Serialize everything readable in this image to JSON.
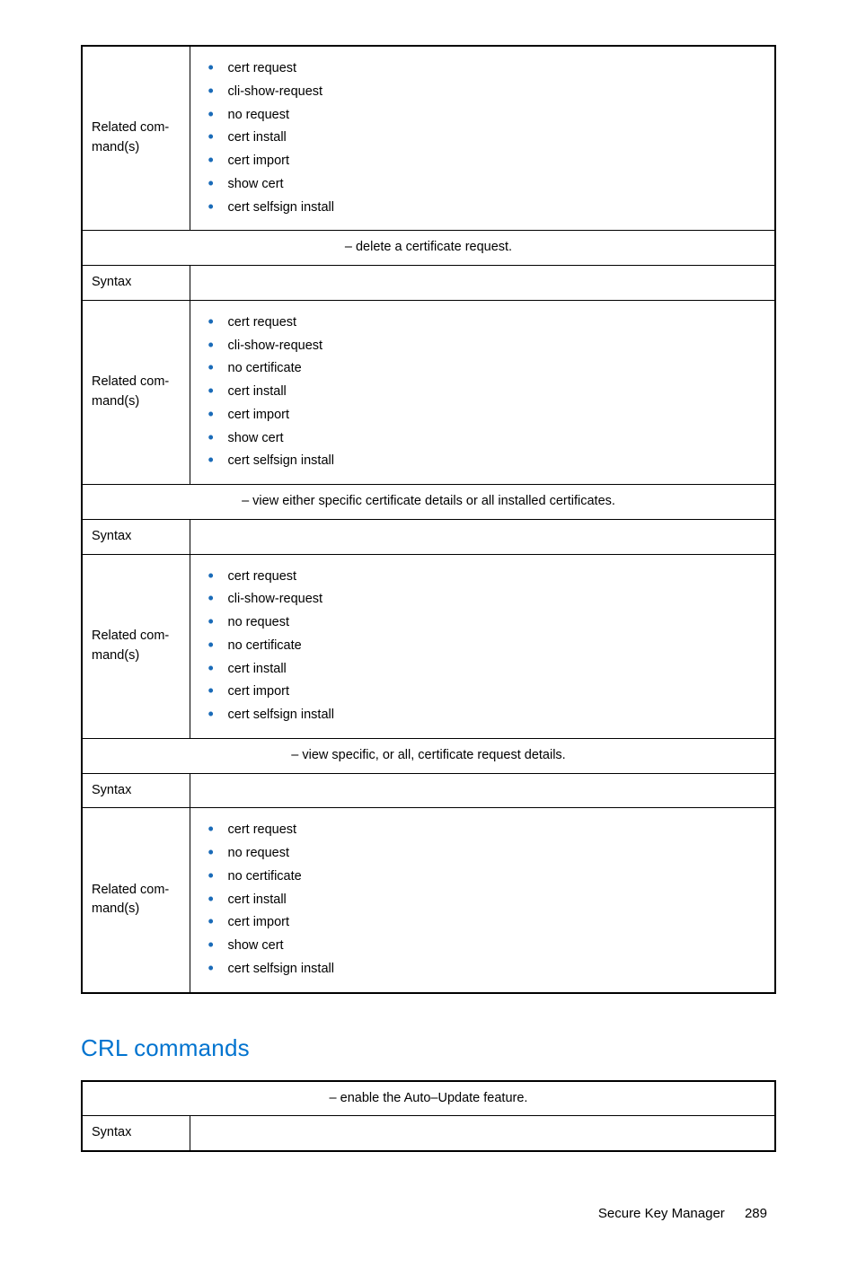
{
  "labels": {
    "related": "Related com­mand(s)",
    "syntax": "Syntax"
  },
  "table1": {
    "row1_items": [
      "cert request",
      "cli-show-request",
      "no request",
      "cert install",
      "cert import",
      "show cert",
      "cert selfsign install"
    ],
    "desc1": "– delete a certificate request.",
    "row2_items": [
      "cert request",
      "cli-show-request",
      "no certificate",
      "cert install",
      "cert import",
      "show cert",
      "cert selfsign install"
    ],
    "desc2": "– view either specific certificate details or all installed certificates.",
    "row3_items": [
      "cert request",
      "cli-show-request",
      "no request",
      "no certificate",
      "cert install",
      "cert import",
      "cert selfsign install"
    ],
    "desc3": "– view specific, or all, certificate request details.",
    "row4_items": [
      "cert request",
      "no request",
      "no certificate",
      "cert install",
      "cert import",
      "show cert",
      "cert selfsign install"
    ]
  },
  "heading": "CRL commands",
  "table2": {
    "desc": "– enable the Auto–Update feature."
  },
  "footer": {
    "doc": "Secure Key Manager",
    "page": "289"
  }
}
